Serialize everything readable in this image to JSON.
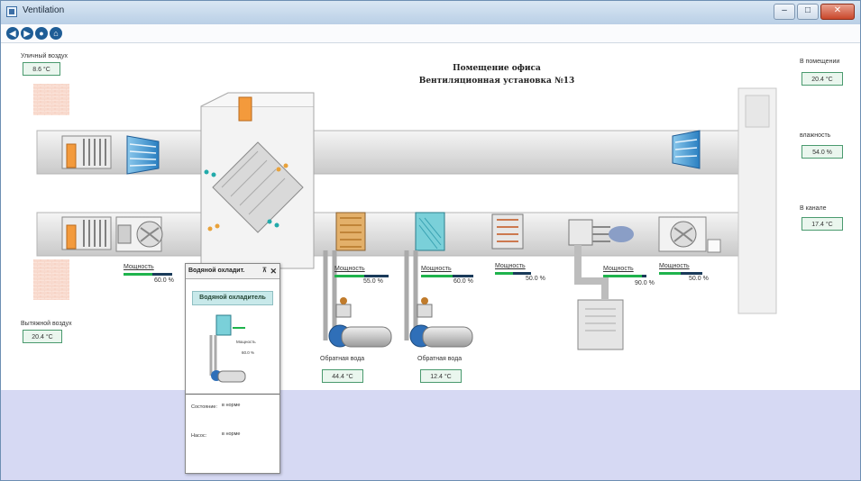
{
  "window": {
    "title": "Ventilation",
    "controls": {
      "minimize": "–",
      "maximize": "□",
      "close": "✕"
    }
  },
  "nav": {
    "back": "◀",
    "forward": "▶",
    "reload": "●",
    "home": "⌂"
  },
  "header": {
    "title": "Помещение офиса",
    "subtitle": "Вентиляционная установка №13"
  },
  "sensors": {
    "outdoor": {
      "label": "Уличный воздух",
      "value": "8.6 °C"
    },
    "exhaust": {
      "label": "Вытяжной воздух",
      "value": "20.4 °C"
    },
    "room": {
      "label": "В помещении",
      "value": "20.4 °C"
    },
    "humidity": {
      "label": "влажность",
      "value": "54.0 %"
    },
    "channel": {
      "label": "В канале",
      "value": "17.4 °C"
    }
  },
  "power_label": "Мощность",
  "units": [
    {
      "name": "exhaust-fan",
      "percent": "60.0 %",
      "power": 0.6
    },
    {
      "name": "heater",
      "percent": "55.0 %",
      "power": 0.55
    },
    {
      "name": "water-cooler",
      "percent": "60.0 %",
      "power": 0.6
    },
    {
      "name": "freon-cooler",
      "percent": "50.0 %",
      "power": 0.5
    },
    {
      "name": "humidifier",
      "percent": "90.0 %",
      "power": 0.9
    },
    {
      "name": "supply-fan",
      "percent": "50.0 %",
      "power": 0.5
    }
  ],
  "return_water": [
    {
      "label": "Обратная вода",
      "value": "44.4 °C"
    },
    {
      "label": "Обратная вода",
      "value": "12.4 °C"
    }
  ],
  "popup": {
    "tab": "Водяной охладит.",
    "pin": "⊼",
    "close": "✕",
    "title": "Водяной охладитель",
    "mini_power_label": "Мощность",
    "mini_percent": "60.0 %",
    "state_label": "Состояние:",
    "state_value": "в норме",
    "pump_label": "Насос:",
    "pump_value": "в норме"
  },
  "colors": {
    "accent": "#1f5d96",
    "bar": "#1fb34c",
    "value_border": "#4a9a6e",
    "floor": "#d6d9f3"
  }
}
